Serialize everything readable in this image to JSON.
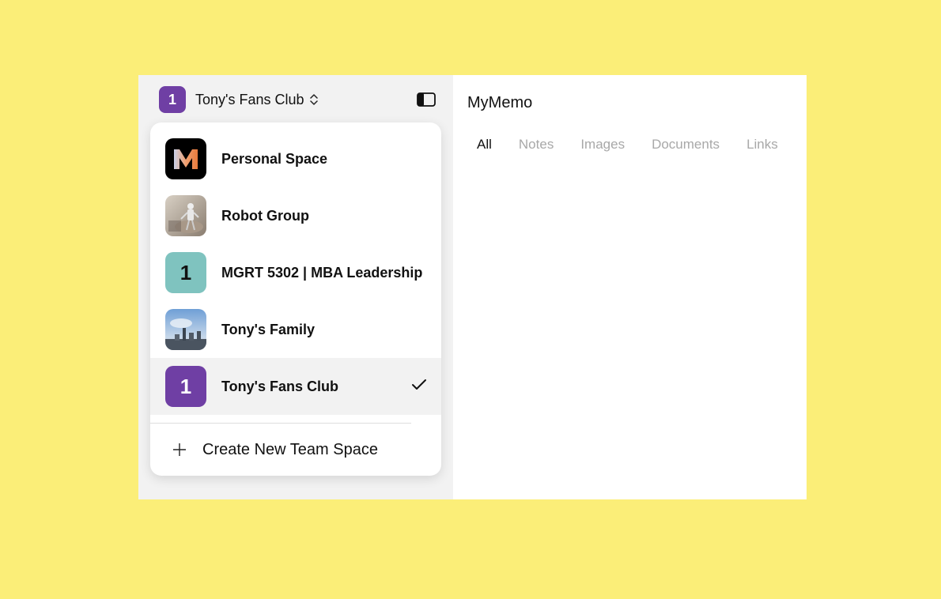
{
  "header": {
    "team_badge": "1",
    "team_name": "Tony's Fans Club",
    "badge_color": "#6f3fa4"
  },
  "dropdown": {
    "items": [
      {
        "label": "Personal Space",
        "avatar": "memo-logo"
      },
      {
        "label": "Robot Group",
        "avatar": "robot-photo"
      },
      {
        "label": "MGRT 5302 | MBA Leadership",
        "avatar": "number-badge",
        "badge": "1",
        "color": "#7fc3bf"
      },
      {
        "label": "Tony's Family",
        "avatar": "city-photo"
      },
      {
        "label": "Tony's Fans Club",
        "avatar": "number-badge",
        "badge": "1",
        "color": "#6f3fa4",
        "selected": true
      }
    ],
    "create_label": "Create New Team Space"
  },
  "main": {
    "title": "MyMemo",
    "tabs": [
      {
        "label": "All",
        "active": true
      },
      {
        "label": "Notes"
      },
      {
        "label": "Images"
      },
      {
        "label": "Documents"
      },
      {
        "label": "Links"
      }
    ]
  },
  "colors": {
    "background": "#fbee78",
    "sidebar": "#f2f2f2",
    "tab_inactive": "#a8a8a8"
  }
}
